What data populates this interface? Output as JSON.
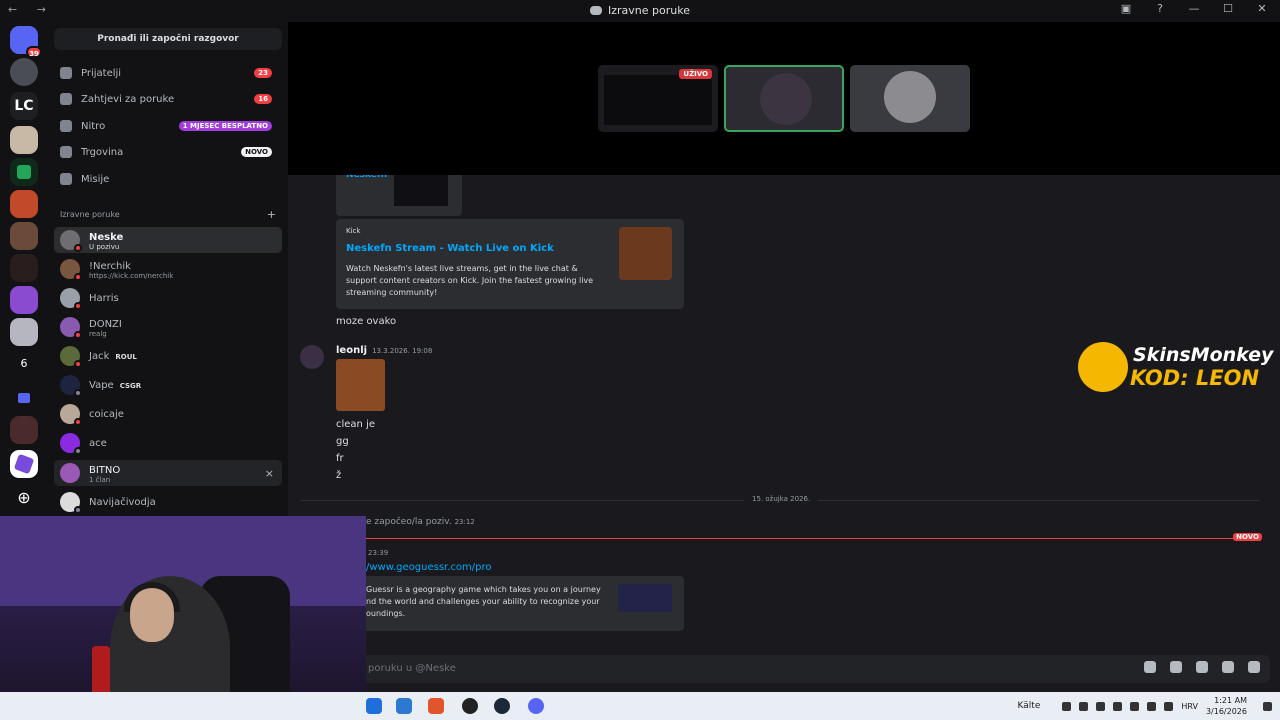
{
  "window": {
    "title": "Izravne poruke",
    "nav_arrows": "← →"
  },
  "rail": {
    "home_badge": "39",
    "number_server": "6"
  },
  "sidebar": {
    "search_label": "Pronađi ili započni razgovor",
    "nav": [
      {
        "label": "Prijatelji",
        "badge": "23"
      },
      {
        "label": "Zahtjevi za poruke",
        "badge": "16"
      },
      {
        "label": "Nitro",
        "badge": "1 MJESEC BESPLATNO"
      },
      {
        "label": "Trgovina",
        "badge": "NOVO"
      },
      {
        "label": "Misije"
      }
    ],
    "dm_header": "Izravne poruke",
    "dm_add": "+",
    "dms": [
      {
        "name": "Neske",
        "sub": "U pozivu"
      },
      {
        "name": "!Nerchik",
        "sub": "https://kick.com/nerchik"
      },
      {
        "name": "Harris"
      },
      {
        "name": "DONZI",
        "sub": "realg"
      },
      {
        "name": "Jack",
        "tag": "ROUL"
      },
      {
        "name": "Vape",
        "tag": "CSGR"
      },
      {
        "name": "coicaje"
      },
      {
        "name": "ace"
      },
      {
        "name": "BITNO",
        "sub": "1 član",
        "close": "×"
      },
      {
        "name": "Navijačivodja"
      }
    ]
  },
  "call": {
    "live_label": "UŽIVO"
  },
  "chat": {
    "partial_link": "Neskefn",
    "embed1": {
      "provider": "Kick",
      "title": "Neskefn Stream - Watch Live on Kick",
      "description": "Watch Neskefn's latest live streams, get in the live chat & support content creators on Kick. Join the fastest growing live streaming community!"
    },
    "msg_moze": "moze ovako",
    "author": "leonlj",
    "author_time": "13.3.2026. 19:08",
    "lines": [
      "clean je",
      "gg",
      "fr",
      "ž"
    ],
    "date_divider": "15. ožujka 2026.",
    "call_notice": "e započeo/la poziv.",
    "call_time": "23:12",
    "new_label": "NOVO",
    "msg_time": "23:39",
    "link": "/www.geoguessr.com/pro",
    "embed2": {
      "description": "Guessr is a geography game which takes you on a journey nd the world and challenges your ability to recognize your oundings."
    },
    "composer_placeholder": "poruku u @Neske"
  },
  "sponsor": {
    "brand": "SkinsMonkey",
    "code": "KOD: LEON"
  },
  "taskbar": {
    "weather": "Kälte",
    "lang": "HRV",
    "time": "1:21 AM",
    "date": "3/16/2026"
  },
  "colors": {
    "accent_red": "#f23f43",
    "link_blue": "#00a8fc",
    "nitro_purple": "#a23ddb",
    "sponsor_yellow": "#f5b700"
  }
}
